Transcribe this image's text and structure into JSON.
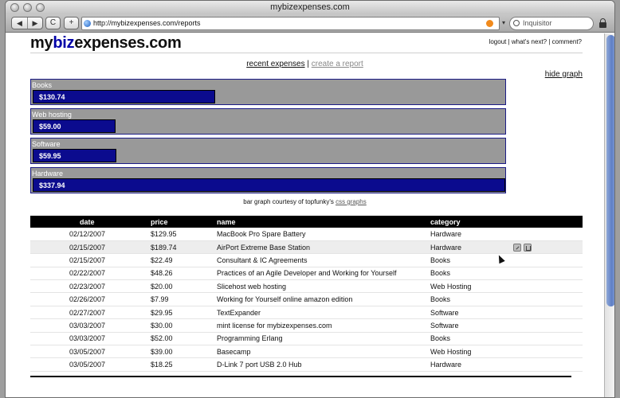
{
  "window": {
    "title": "mybizexpenses.com"
  },
  "toolbar": {
    "back_glyph": "◀",
    "forward_glyph": "▶",
    "reload_glyph": "C",
    "add_glyph": "+",
    "url": "http://mybizexpenses.com/reports",
    "search_placeholder": "Inquisitor",
    "dropdown_glyph": "▾"
  },
  "header": {
    "logo_my": "my",
    "logo_biz": "biz",
    "logo_rest": "expenses.com",
    "links": {
      "logout": "logout",
      "sep1": " | ",
      "whats_next": "what's next?",
      "sep2": " | ",
      "comment": "comment?"
    }
  },
  "nav": {
    "recent": "recent expenses",
    "sep": " | ",
    "create": "create a report"
  },
  "hide_graph": "hide graph",
  "chart_data": {
    "type": "bar",
    "categories": [
      "Books",
      "Web hosting",
      "Software",
      "Hardware"
    ],
    "values": [
      130.74,
      59.0,
      59.95,
      337.94
    ],
    "labels": [
      "$130.74",
      "$59.00",
      "$59.95",
      "$337.94"
    ],
    "max": 337.94
  },
  "credit": {
    "text": "bar graph courtesy of topfunky's ",
    "link": "css graphs"
  },
  "table": {
    "headers": {
      "date": "date",
      "price": "price",
      "name": "name",
      "category": "category"
    },
    "rows": [
      {
        "date": "02/12/2007",
        "price": "$129.95",
        "name": "MacBook Pro Spare Battery",
        "category": "Hardware"
      },
      {
        "date": "02/15/2007",
        "price": "$189.74",
        "name": "AirPort Extreme Base Station",
        "category": "Hardware"
      },
      {
        "date": "02/15/2007",
        "price": "$22.49",
        "name": "Consultant & IC Agreements",
        "category": "Books"
      },
      {
        "date": "02/22/2007",
        "price": "$48.26",
        "name": "Practices of an Agile Developer and Working for Yourself",
        "category": "Books"
      },
      {
        "date": "02/23/2007",
        "price": "$20.00",
        "name": "Slicehost web hosting",
        "category": "Web Hosting"
      },
      {
        "date": "02/26/2007",
        "price": "$7.99",
        "name": "Working for Yourself online amazon edition",
        "category": "Books"
      },
      {
        "date": "02/27/2007",
        "price": "$29.95",
        "name": "TextExpander",
        "category": "Software"
      },
      {
        "date": "03/03/2007",
        "price": "$30.00",
        "name": "mint license for mybizexpenses.com",
        "category": "Software"
      },
      {
        "date": "03/03/2007",
        "price": "$52.00",
        "name": "Programming Erlang",
        "category": "Books"
      },
      {
        "date": "03/05/2007",
        "price": "$39.00",
        "name": "Basecamp",
        "category": "Web Hosting"
      },
      {
        "date": "03/05/2007",
        "price": "$18.25",
        "name": "D-Link 7 port USB 2.0 Hub",
        "category": "Hardware"
      }
    ],
    "highlighted_row": 1
  },
  "colors": {
    "bar_fill": "#0b0b8e",
    "bar_bg": "#999999",
    "logo_accent": "#0000a8",
    "header_bg": "#000000"
  }
}
